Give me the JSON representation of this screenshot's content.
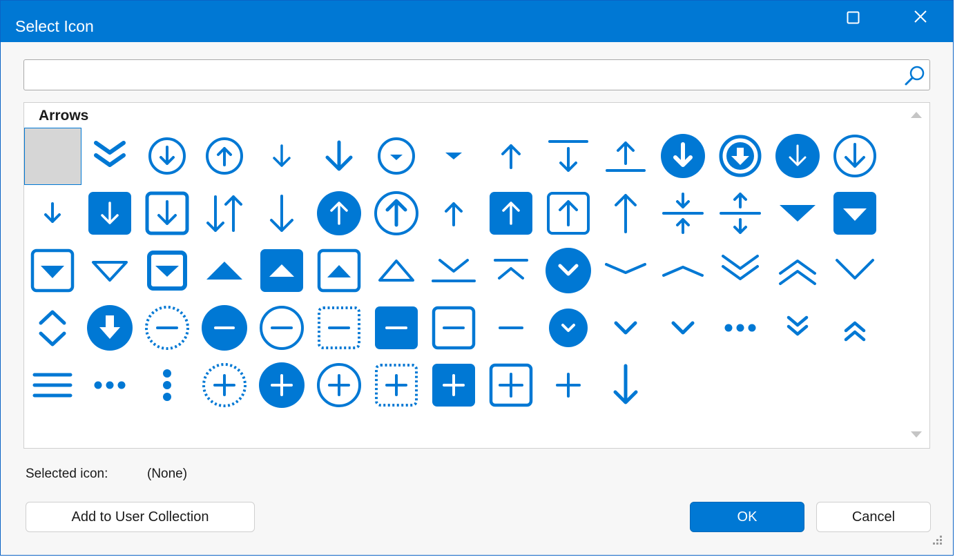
{
  "window": {
    "title": "Select Icon"
  },
  "search": {
    "value": "",
    "placeholder": ""
  },
  "gallery": {
    "category": "Arrows",
    "accent": "#0078d4",
    "icons": [
      "empty-selected",
      "double-chevron-down",
      "circle-arrow-down",
      "circle-arrow-up",
      "arrow-down-small",
      "arrow-down-large",
      "circle-caret-down",
      "caret-down-small",
      "arrow-up-small",
      "arrow-down-to-bar",
      "arrow-up-from-bar",
      "filled-circle-arrow-down",
      "bold-circle-arrow-down",
      "filled-circle-arrow-down-thin",
      "circle-arrow-down-outline",
      "arrow-down-tiny",
      "filled-square-arrow-down",
      "square-arrow-down",
      "arrows-down-up",
      "arrow-down-long",
      "filled-circle-arrow-up",
      "circle-arrow-up-large",
      "arrow-up-small-2",
      "filled-square-arrow-up",
      "square-arrow-up",
      "arrow-up-long",
      "arrows-collapse-vertical",
      "arrows-expand-vertical",
      "triangle-down-filled",
      "filled-square-triangle-down",
      "square-triangle-down",
      "triangle-down-outline",
      "square-triangle-down-bold",
      "triangle-up-filled",
      "filled-square-triangle-up",
      "square-triangle-up",
      "triangle-up-outline",
      "chevron-down-to-bar",
      "chevron-up-from-bar",
      "filled-circle-chevron-down",
      "chevron-down-wide",
      "chevron-up-wide",
      "double-chevron-down-thin",
      "double-chevron-up-thin",
      "chevron-down-large",
      "chevron-up-down",
      "filled-circle-arrow-down-bold",
      "dotted-circle-minus",
      "filled-circle-minus",
      "circle-minus",
      "dotted-square-minus",
      "filled-square-minus",
      "square-minus",
      "minus",
      "filled-circle-chevron-down-small",
      "chevron-down-small",
      "chevron-down-small-2",
      "ellipsis-horizontal",
      "double-chevron-down-small",
      "double-chevron-up-small",
      "menu-lines",
      "ellipsis-horizontal-2",
      "ellipsis-vertical",
      "dotted-circle-plus",
      "filled-circle-plus",
      "circle-plus",
      "dotted-square-plus",
      "filled-square-plus",
      "square-plus",
      "plus",
      "arrow-down-long-2"
    ]
  },
  "selection": {
    "label": "Selected icon:",
    "value": "(None)"
  },
  "buttons": {
    "add": "Add to User Collection",
    "ok": "OK",
    "cancel": "Cancel"
  }
}
